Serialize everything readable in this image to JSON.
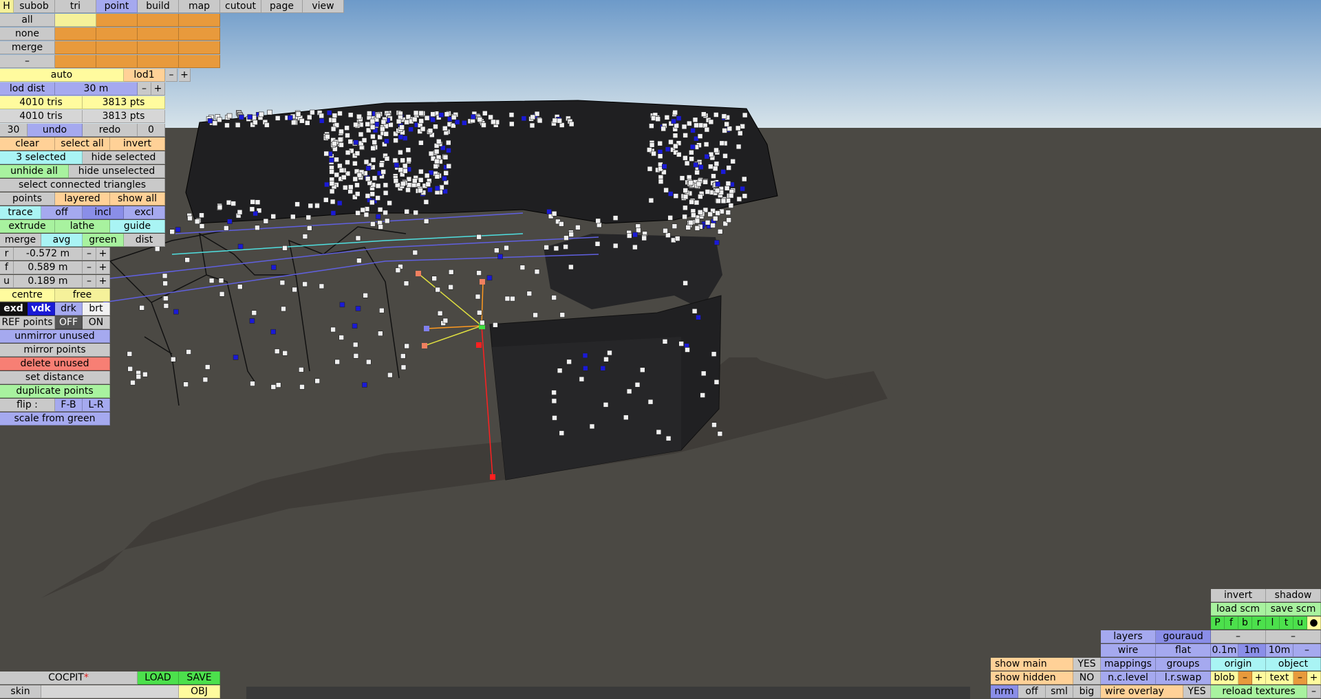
{
  "colors": {
    "sky_top": "#6d9ac9",
    "sky_bottom": "#d8e4ea",
    "ground": "#4b4944",
    "model_dark": "#1f1f21",
    "point_white": "#f0f0f0",
    "point_blue": "#1a1ad6",
    "wire_cyan": "#4fe0e0",
    "wire_blue": "#6060e0",
    "axis_yellow": "#e0e040",
    "axis_red": "#ff2020",
    "axis_orange": "#ff9a20",
    "anchor_green": "#40e040"
  },
  "menu": {
    "h": "H",
    "tabs": [
      "subob",
      "tri",
      "point",
      "build",
      "map",
      "cutout",
      "page",
      "view"
    ],
    "active_tab": "point"
  },
  "selection": {
    "all": "all",
    "none": "none",
    "merge": "merge",
    "dash": "–"
  },
  "lod": {
    "auto": "auto",
    "lod1": "lod1",
    "minus": "–",
    "plus": "+",
    "dist_label": "lod dist",
    "dist_value": "30 m"
  },
  "stats": {
    "tris1": "4010 tris",
    "pts1": "3813 pts",
    "tris2": "4010 tris",
    "pts2": "3813 pts"
  },
  "history": {
    "count": "30",
    "undo": "undo",
    "redo": "redo",
    "redo_count": "0"
  },
  "edit": {
    "clear": "clear",
    "select_all": "select all",
    "invert": "invert",
    "selected": "3 selected",
    "hide_selected": "hide selected",
    "unhide_all": "unhide all",
    "hide_unselected": "hide unselected",
    "select_connected": "select connected triangles",
    "points": "points",
    "layered": "layered",
    "show_all": "show all",
    "trace": "trace",
    "off": "off",
    "incl": "incl",
    "excl": "excl",
    "extrude": "extrude",
    "lathe": "lathe",
    "guide": "guide",
    "merge": "merge",
    "avg": "avg",
    "green": "green",
    "dist": "dist"
  },
  "coords": {
    "r_label": "r",
    "r_value": "-0.572 m",
    "f_label": "f",
    "f_value": "0.589 m",
    "u_label": "u",
    "u_value": "0.189 m",
    "minus": "–",
    "plus": "+",
    "centre": "centre",
    "free": "free"
  },
  "display": {
    "exd": "exd",
    "vdk": "vdk",
    "drk": "drk",
    "brt": "brt",
    "ref_points": "REF points",
    "off": "OFF",
    "on": "ON"
  },
  "actions": {
    "unmirror": "unmirror unused",
    "mirror": "mirror points",
    "delete": "delete unused",
    "set_distance": "set distance",
    "duplicate": "duplicate points",
    "flip": "flip :",
    "fb": "F-B",
    "lr": "L-R",
    "scale": "scale from green"
  },
  "file": {
    "name": "COCPIT",
    "modified": "*",
    "load": "LOAD",
    "save": "SAVE",
    "skin": "skin",
    "obj": "OBJ"
  },
  "right_panel": {
    "invert": "invert",
    "shadow": "shadow",
    "load_scm": "load scm",
    "save_scm": "save scm",
    "views": [
      "P",
      "f",
      "b",
      "r",
      "l",
      "t",
      "u"
    ],
    "dot": "●",
    "dash": "–",
    "layers": "layers",
    "gouraud": "gouraud",
    "wire": "wire",
    "flat": "flat",
    "grid": [
      "0.1m",
      "1m",
      "10m"
    ],
    "show_main": "show main",
    "show_main_val": "YES",
    "mappings": "mappings",
    "groups": "groups",
    "origin": "origin",
    "object": "object",
    "show_hidden": "show hidden",
    "show_hidden_val": "NO",
    "nc_level": "n.c.level",
    "lr_swap": "l.r.swap",
    "blob": "blob",
    "minus": "–",
    "plus": "+",
    "text": "text",
    "nrm": "nrm",
    "off": "off",
    "sml": "sml",
    "big": "big",
    "wire_overlay": "wire overlay",
    "wire_overlay_val": "YES",
    "reload": "reload textures"
  }
}
